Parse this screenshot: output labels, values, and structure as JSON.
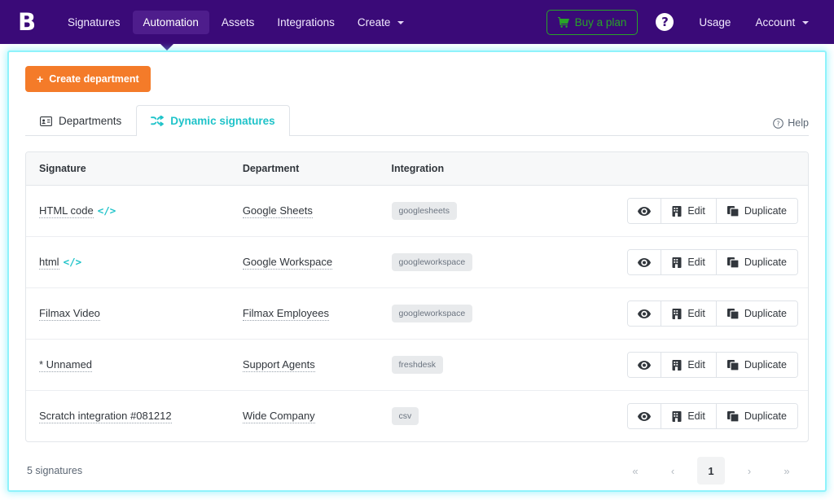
{
  "navbar": {
    "logo": "B",
    "items": [
      {
        "label": "Signatures",
        "active": false,
        "caret": false
      },
      {
        "label": "Automation",
        "active": true,
        "caret": false
      },
      {
        "label": "Assets",
        "active": false,
        "caret": false
      },
      {
        "label": "Integrations",
        "active": false,
        "caret": false
      },
      {
        "label": "Create",
        "active": false,
        "caret": true
      }
    ],
    "buy_plan_label": "Buy a plan",
    "help_glyph": "?",
    "usage_label": "Usage",
    "account_label": "Account",
    "colors": {
      "bar": "#3a0a78",
      "active_item": "#4e1d8c",
      "buy_plan": "#28a428"
    }
  },
  "card": {
    "create_button": {
      "plus": "+",
      "label": "Create department"
    },
    "tabs": [
      {
        "label": "Departments",
        "icon": "id-card-icon",
        "active": false
      },
      {
        "label": "Dynamic signatures",
        "icon": "shuffle-icon",
        "active": true
      }
    ],
    "help_label": "Help",
    "accent_border": "#8ff3fb",
    "tab_active_color": "#1fc3c9"
  },
  "table": {
    "columns": [
      "Signature",
      "Department",
      "Integration"
    ],
    "rows": [
      {
        "signature": "HTML code",
        "has_code_icon": true,
        "department": "Google Sheets",
        "integration": "googlesheets",
        "actions": {
          "view": "",
          "edit": "Edit",
          "duplicate": "Duplicate"
        }
      },
      {
        "signature": "html",
        "has_code_icon": true,
        "department": "Google Workspace",
        "integration": "googleworkspace",
        "actions": {
          "view": "",
          "edit": "Edit",
          "duplicate": "Duplicate"
        }
      },
      {
        "signature": "Filmax Video",
        "has_code_icon": false,
        "department": "Filmax Employees",
        "integration": "googleworkspace",
        "actions": {
          "view": "",
          "edit": "Edit",
          "duplicate": "Duplicate"
        }
      },
      {
        "signature": "* Unnamed",
        "has_code_icon": false,
        "department": "Support Agents",
        "integration": "freshdesk",
        "actions": {
          "view": "",
          "edit": "Edit",
          "duplicate": "Duplicate"
        }
      },
      {
        "signature": "Scratch integration #081212",
        "has_code_icon": false,
        "department": "Wide Company",
        "integration": "csv",
        "actions": {
          "view": "",
          "edit": "Edit",
          "duplicate": "Duplicate"
        }
      }
    ]
  },
  "footer": {
    "count_label": "5 signatures",
    "pagination": {
      "first": "«",
      "prev": "‹",
      "current_page": "1",
      "next": "›",
      "last": "»"
    }
  }
}
